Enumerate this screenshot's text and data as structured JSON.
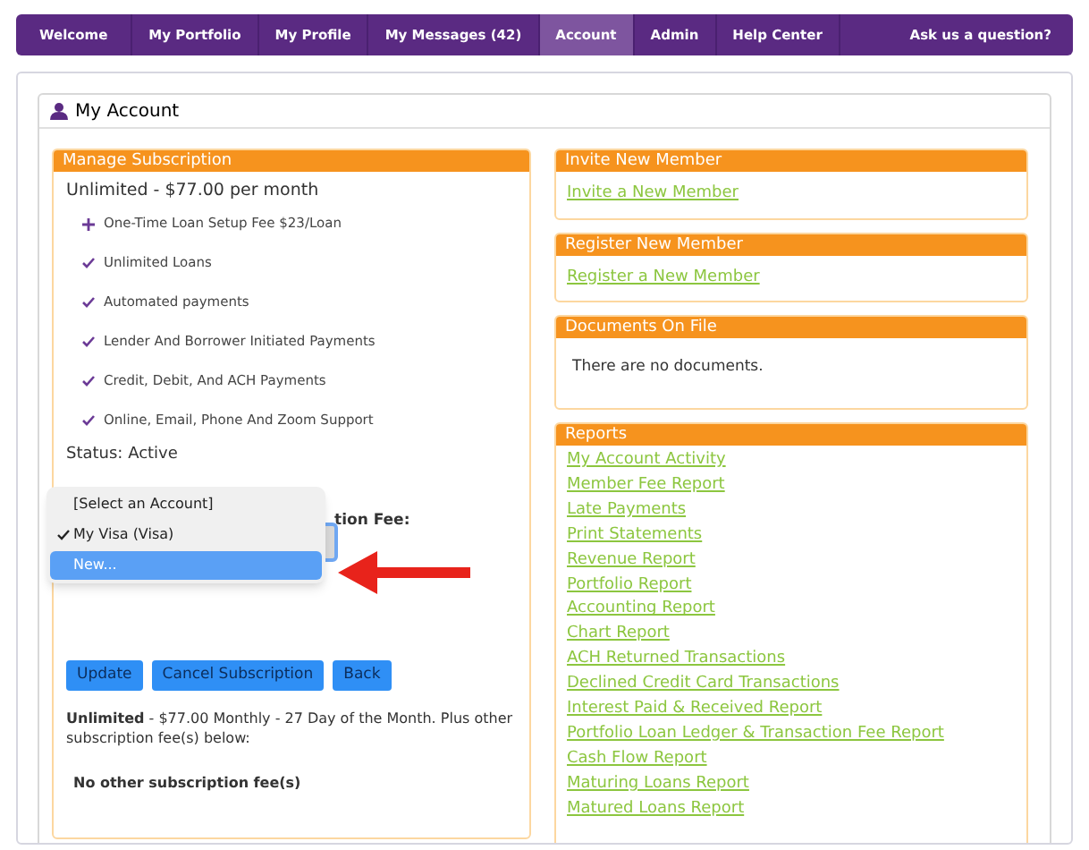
{
  "nav": [
    {
      "label": "Welcome",
      "selected": false
    },
    {
      "label": "My Portfolio",
      "selected": false
    },
    {
      "label": "My Profile",
      "selected": false
    },
    {
      "label": "My Messages (42)",
      "selected": false
    },
    {
      "label": "Account",
      "selected": true
    },
    {
      "label": "Admin",
      "selected": false
    },
    {
      "label": "Help Center",
      "selected": false
    }
  ],
  "nav_right": "Ask us a question?",
  "page_title": "My Account",
  "subscription": {
    "title": "Manage Subscription",
    "plan": "Unlimited - $77.00 per month",
    "features": [
      {
        "kind": "plus",
        "text": "One-Time Loan Setup Fee $23/Loan"
      },
      {
        "kind": "check",
        "text": "Unlimited Loans"
      },
      {
        "kind": "check",
        "text": "Automated payments"
      },
      {
        "kind": "check",
        "text": "Lender And Borrower Initiated Payments"
      },
      {
        "kind": "check",
        "text": "Credit, Debit, And ACH Payments"
      },
      {
        "kind": "check",
        "text": "Online, Email, Phone And Zoom Support"
      }
    ],
    "status": "Status: Active",
    "fee_label": "tion Fee:",
    "dropdown_options": [
      {
        "label": "[Select an Account]",
        "checked": false,
        "selected": false
      },
      {
        "label": "My Visa (Visa)",
        "checked": true,
        "selected": false
      },
      {
        "label": "New...",
        "checked": false,
        "selected": true
      }
    ],
    "buttons": [
      "Update",
      "Cancel Subscription",
      "Back"
    ],
    "summary": "**Unlimited** - $77.00 Monthly - 27 Day of the Month. Plus other subscription fee(s) below:",
    "other_fees": "No other subscription fee(s)"
  },
  "invite": {
    "title": "Invite New Member",
    "link": "Invite a New Member"
  },
  "register": {
    "title": "Register New Member",
    "link": "Register a New Member"
  },
  "documents": {
    "title": "Documents On File",
    "text": "There are no documents."
  },
  "reports": {
    "title": "Reports",
    "links": [
      "My Account Activity",
      "Member Fee Report",
      "Late Payments",
      "Print Statements",
      "Revenue Report",
      "Portfolio Report",
      "Accounting Report",
      "Chart Report",
      "ACH Returned Transactions",
      "Declined Credit Card Transactions",
      "Interest Paid & Received Report",
      "Portfolio Loan Ledger & Transaction Fee Report",
      "Cash Flow Report",
      "Maturing Loans Report",
      "Matured Loans Report"
    ]
  }
}
